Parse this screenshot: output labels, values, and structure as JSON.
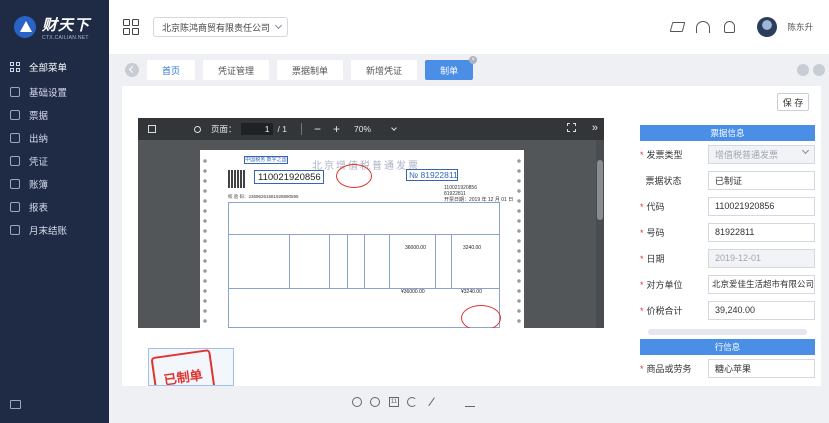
{
  "app": {
    "logo_cn": "财天下",
    "logo_en": "CTX.CAILIAN.NET"
  },
  "sidebar": {
    "items": [
      {
        "label": "全部菜单",
        "icon": "grid-icon"
      },
      {
        "label": "基础设置",
        "icon": "settings-icon"
      },
      {
        "label": "票据",
        "icon": "receipt-icon"
      },
      {
        "label": "出纳",
        "icon": "cashier-icon"
      },
      {
        "label": "凭证",
        "icon": "voucher-icon"
      },
      {
        "label": "账簿",
        "icon": "ledger-icon"
      },
      {
        "label": "报表",
        "icon": "report-icon"
      },
      {
        "label": "月末结账",
        "icon": "month-end-icon"
      }
    ]
  },
  "header": {
    "company": "北京陈鸿商贸有限责任公司",
    "username": "陈东升"
  },
  "tabs": [
    {
      "label": "首页"
    },
    {
      "label": "凭证管理"
    },
    {
      "label": "票据制单"
    },
    {
      "label": "新增凭证"
    },
    {
      "label": "制单"
    }
  ],
  "toolbar": {
    "save_label": "保 存"
  },
  "viewer": {
    "page_label": "页面：",
    "page_current": "1",
    "page_total": "/ 1",
    "zoom": "70%"
  },
  "invoice": {
    "tag": "中国税务 数字之国",
    "title": "北京增值税普通发票",
    "code": "110021920856",
    "number": "81922811",
    "number_prefix": "№",
    "small_code": "110021920856",
    "small_no": "81922811",
    "date_line": "开票日期：2019 年 12 月 01 日",
    "check_line": "校 验 码：23696261581928890595",
    "amount": "36000.00",
    "tax": "3240.00",
    "total_amount": "¥36000.00",
    "total_tax": "¥3240.00"
  },
  "thumbnail": {
    "stamp_text": "已制单"
  },
  "form": {
    "section1_title": "票据信息",
    "section2_title": "行信息",
    "fields": [
      {
        "label": "发票类型",
        "value": "增值税普通发票",
        "required": true
      },
      {
        "label": "票据状态",
        "value": "已制证",
        "required": false
      },
      {
        "label": "代码",
        "value": "110021920856",
        "required": true
      },
      {
        "label": "号码",
        "value": "81922811",
        "required": true
      },
      {
        "label": "日期",
        "value": "2019-12-01",
        "required": true
      },
      {
        "label": "对方单位",
        "value": "北京爱佳生活超市有限公司",
        "required": true
      },
      {
        "label": "价税合计",
        "value": "39,240.00",
        "required": true
      }
    ],
    "line_field": {
      "label": "商品或劳务",
      "value": "糖心苹果",
      "required": true
    },
    "required_mark": "*"
  }
}
